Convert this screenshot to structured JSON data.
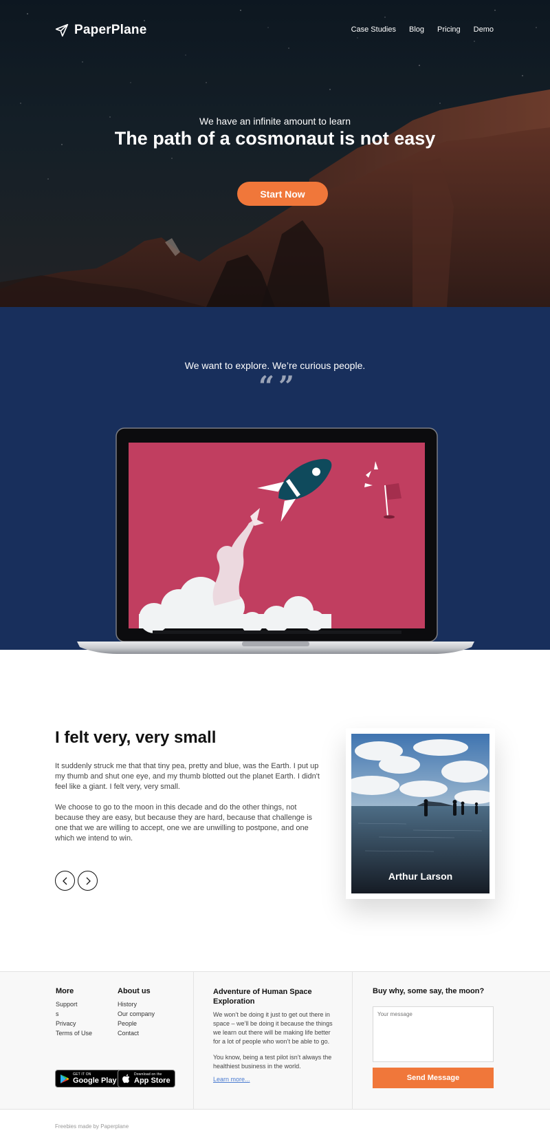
{
  "header": {
    "brand": "PaperPlane",
    "nav": [
      "Case Studies",
      "Blog",
      "Pricing",
      "Demo"
    ]
  },
  "hero": {
    "kicker": "We have an infinite amount to learn",
    "title": "The path of a cosmonaut is not easy",
    "cta_label": "Start Now"
  },
  "band": {
    "tagline": "We want to explore. We’re curious people.",
    "quote_mark": "“ ”"
  },
  "story": {
    "title": "I felt very, very small",
    "paragraph1": "It suddenly struck me that that tiny pea, pretty and blue, was the Earth. I put up my thumb and shut one eye, and my thumb blotted out the planet Earth. I didn't feel like a giant. I felt very, very small.",
    "paragraph2": "We choose to go to the moon in this decade and do the other things, not because they are easy, but because they are hard, because that challenge is one that we are willing to accept, one we are unwilling to postpone, and one which we intend to win.",
    "person_name": "Arthur Larson"
  },
  "footer": {
    "more": {
      "heading": "More",
      "links": [
        "Support",
        "s",
        "Privacy",
        "Terms of Use"
      ]
    },
    "about": {
      "heading": "About us",
      "links": [
        "History",
        "Our company",
        "People",
        "Contact"
      ]
    },
    "adventure": {
      "heading": "Adventure of Human Space Exploration",
      "text1": "We won’t be doing it just to get out there in space – we’ll be doing it because the things we learn out there will be making life better for a lot of people who won’t be able to go.",
      "text2": "You know, being a test pilot isn’t always the healthiest business in the world.",
      "link": "Learn more..."
    },
    "contact": {
      "heading": "Buy why, some say, the moon?",
      "placeholder": "Your message",
      "button": "Send Message"
    },
    "stores": {
      "google_small": "GET IT ON",
      "google_big": "Google Play",
      "apple_small": "Download on the",
      "apple_big": "App Store"
    },
    "credit": "Freebies made by Paperplane"
  },
  "colors": {
    "accent": "#f0773a",
    "band": "#182f5c",
    "screen": "#c13e60",
    "rocket": "#0f4a5c"
  }
}
